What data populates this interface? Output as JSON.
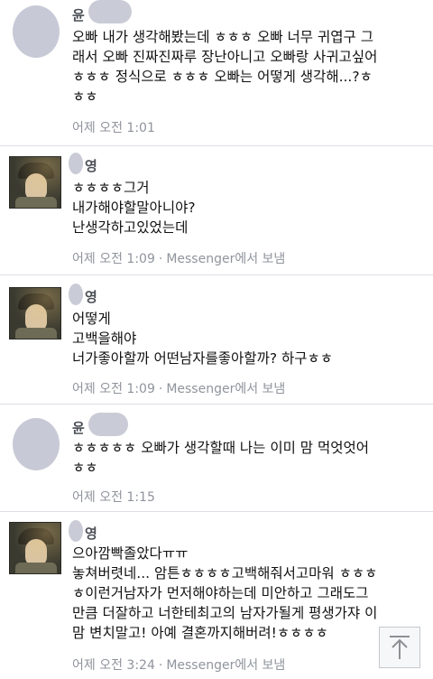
{
  "messages": [
    {
      "sender": "윤",
      "avatar": "blurred-avatar",
      "lines": [
        "오빠 내가 생각해봤는데 ㅎㅎㅎ 오빠 너무 귀엽구 그",
        "래서 오빠 진짜진짜루 장난아니고 오빠랑 사귀고싶어",
        "ㅎㅎㅎ 정식으로 ㅎㅎㅎ 오빠는 어떻게 생각해...?ㅎ",
        "ㅎㅎ"
      ],
      "time": "어제 오전 1:01",
      "via": ""
    },
    {
      "sender": "영",
      "avatar": "photo-avatar",
      "lines": [
        "ㅎㅎㅎㅎ그거",
        "내가해야할말아니야?",
        "난생각하고있었는데"
      ],
      "time": "어제 오전 1:09",
      "via": "Messenger에서 보냄"
    },
    {
      "sender": "영",
      "avatar": "photo-avatar",
      "lines": [
        "어떻게",
        "고백을해야",
        "너가좋아할까 어떤남자를좋아할까? 하구ㅎㅎ"
      ],
      "time": "어제 오전 1:09",
      "via": "Messenger에서 보냄"
    },
    {
      "sender": "윤",
      "avatar": "blurred-avatar",
      "lines": [
        "ㅎㅎㅎㅎㅎ 오빠가 생각할때 나는 이미 맘 먹엇엇어",
        "ㅎㅎ"
      ],
      "time": "어제 오전 1:15",
      "via": ""
    },
    {
      "sender": "영",
      "avatar": "photo-avatar",
      "lines": [
        "으아깜빡졸았다ㅠㅠ",
        "놓쳐버렷네... 암튼ㅎㅎㅎㅎ고백해줘서고마워 ㅎㅎㅎ",
        "ㅎ이런거남자가 먼저해야하는데 미안하고 그래도그",
        "만큼 더잘하고 너한테최고의 남자가될게 평생가쟈 이",
        "맘 변치말고! 아예 결혼까지해버려!ㅎㅎㅎㅎ"
      ],
      "time": "어제 오전 3:24",
      "via": "Messenger에서 보냄"
    }
  ],
  "icons": {
    "scroll_top": "arrow-up-icon"
  },
  "colors": {
    "meta_text": "#90949c",
    "name_text": "#4b4f56",
    "divider": "#dcdfe4",
    "blur": "#c7cad6"
  }
}
